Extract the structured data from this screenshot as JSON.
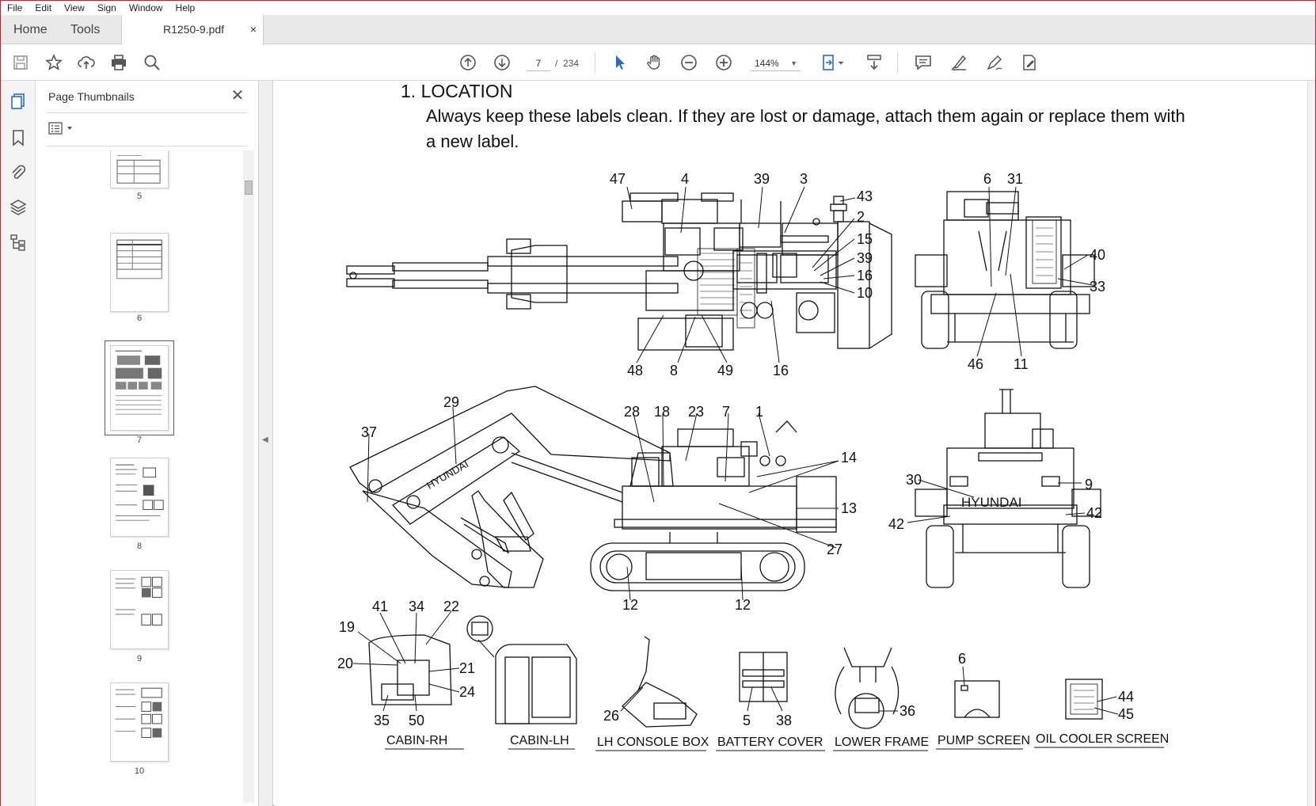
{
  "menu": [
    "File",
    "Edit",
    "View",
    "Sign",
    "Window",
    "Help"
  ],
  "tabs": {
    "home": "Home",
    "tools": "Tools",
    "document": "R1250-9.pdf",
    "close": "×"
  },
  "toolbar": {
    "page_current": "7",
    "page_sep": "/",
    "page_total": "234",
    "zoom": "144%"
  },
  "thumbnails": {
    "title": "Page Thumbnails",
    "close": "✕",
    "pages": [
      "5",
      "6",
      "7",
      "8",
      "9",
      "10"
    ],
    "selected": "7"
  },
  "document": {
    "heading": "1.  LOCATION",
    "intro_line1": "Always keep these labels clean.  If they are lost or damage, attach them again or replace them with",
    "intro_line2": "a new label.",
    "captions": [
      "CABIN-RH",
      "CABIN-LH",
      "LH CONSOLE BOX",
      "BATTERY COVER",
      "LOWER FRAME",
      "PUMP SCREEN",
      "OIL COOLER SCREEN"
    ],
    "brand_text": "HYUNDAI",
    "callouts": {
      "top_plan": [
        "47",
        "4",
        "39",
        "3",
        "43",
        "2",
        "15",
        "39",
        "16",
        "10",
        "48",
        "8",
        "49",
        "16"
      ],
      "rear_view": [
        "6",
        "31",
        "40",
        "33",
        "46",
        "11"
      ],
      "side_view": [
        "29",
        "28",
        "18",
        "23",
        "7",
        "1",
        "37",
        "14",
        "13",
        "27",
        "12",
        "12"
      ],
      "front_view": [
        "30",
        "9",
        "42",
        "42"
      ],
      "cabin_rh": [
        "41",
        "34",
        "22",
        "19",
        "20",
        "21",
        "24",
        "35",
        "50"
      ],
      "console": [
        "26"
      ],
      "battery": [
        "5",
        "38"
      ],
      "lower_frame": [
        "36"
      ],
      "pump": [
        "6"
      ],
      "oil_cooler": [
        "44",
        "45"
      ]
    }
  },
  "colors": {
    "accent": "#2d6ac8",
    "frame": "#c8202a",
    "tabbar": "#e9e9e9"
  }
}
